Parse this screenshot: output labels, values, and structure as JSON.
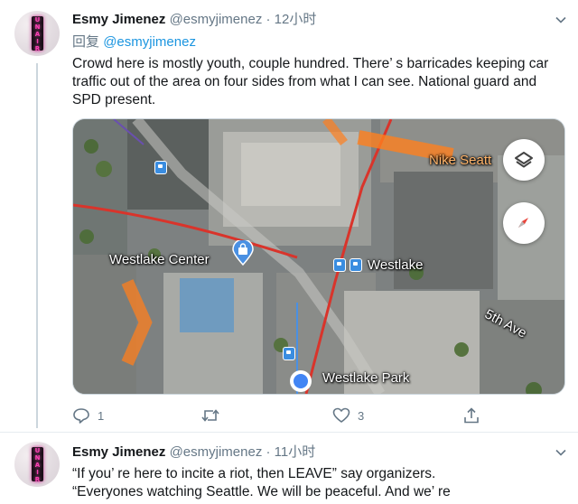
{
  "tweets": [
    {
      "author_name": "Esmy Jimenez",
      "author_handle": "@esmyjimenez",
      "separator": "·",
      "time": "12小时",
      "reply_prefix": "回复",
      "reply_mention": "@esmyjimenez",
      "text": "Crowd here is mostly youth, couple hundred. There’ s barricades keeping car traffic out of the area on four sides from what I can see. National guard and SPD present.",
      "map_labels": {
        "nike": "Nike Seatt",
        "westlake_center": "Westlake Center",
        "westlake_station": "Westlake",
        "fifth_ave": "5th Ave",
        "westlake_park": "Westlake Park"
      },
      "map_icons": [
        "layers-icon",
        "compass-icon",
        "shopping-bag-icon",
        "transit-icon",
        "location-dot-icon"
      ],
      "actions": {
        "replies": "1",
        "retweets": "",
        "likes": "3"
      }
    },
    {
      "author_name": "Esmy Jimenez",
      "author_handle": "@esmyjimenez",
      "separator": "·",
      "time": "11小时",
      "text_line1": "“If you’ re here to incite a riot, then LEAVE” say organizers.",
      "text_line2": "“Everyones watching Seattle. We will be peaceful. And we’ re"
    }
  ],
  "avatar_sign_letters": [
    "U",
    "N",
    "A",
    "I",
    "R"
  ],
  "colors": {
    "link": "#1b95e0",
    "muted": "#657786",
    "text": "#14171a",
    "map_red_route": "#d9342b",
    "map_blue_route": "#4a90e2",
    "traffic_orange": "#ff7f1e"
  }
}
